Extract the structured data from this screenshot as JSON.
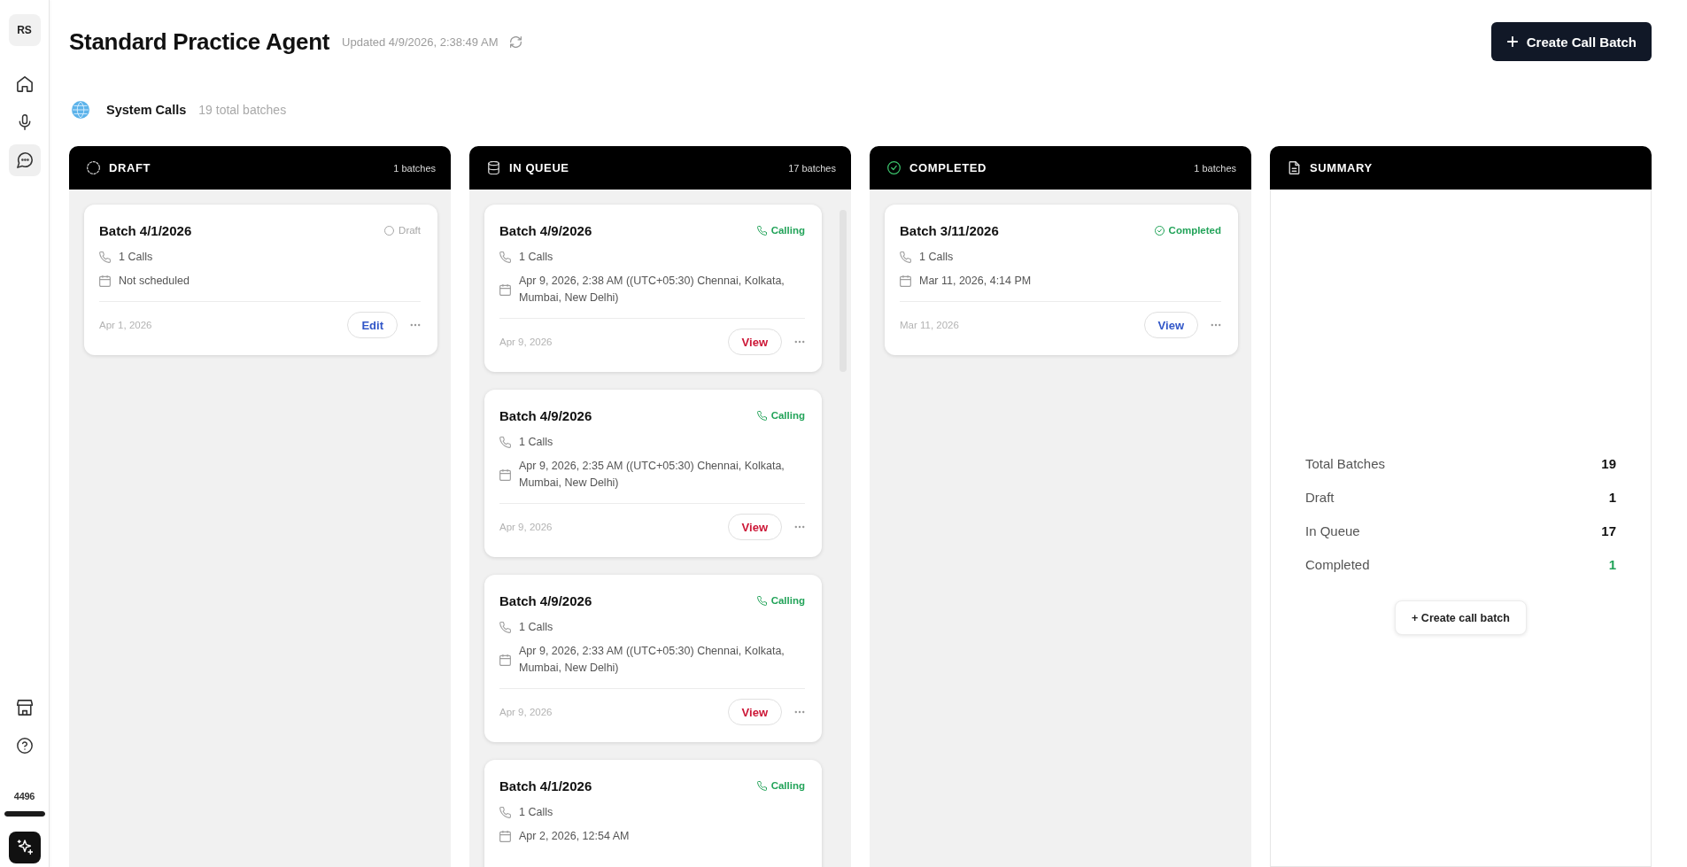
{
  "sidebar": {
    "avatar": "RS",
    "nav_items": [
      {
        "kind": "home",
        "selected": false
      },
      {
        "kind": "mic",
        "selected": false
      },
      {
        "kind": "chat",
        "selected": true
      }
    ],
    "footer_items": [
      {
        "kind": "store"
      },
      {
        "kind": "help"
      }
    ],
    "credits": {
      "value": "4496",
      "level": 1
    }
  },
  "header": {
    "title": "Standard Practice Agent",
    "updated": "Updated 4/9/2026, 2:38:49 AM",
    "create_button": "Create Call Batch"
  },
  "source": {
    "name": "System Calls",
    "count": "19 total batches"
  },
  "columns": [
    {
      "kind": "draft",
      "title": "DRAFT",
      "count": "1 batches",
      "scrollable": false,
      "cards": [
        {
          "title": "Batch 4/1/2026",
          "status": {
            "kind": "draft",
            "label": "Draft"
          },
          "calls": "1 Calls",
          "schedule": "Not scheduled",
          "date": "Apr 1, 2026",
          "action": {
            "kind": "primary",
            "label": "Edit"
          }
        }
      ]
    },
    {
      "kind": "queue",
      "title": "IN QUEUE",
      "count": "17 batches",
      "scrollable": true,
      "cards": [
        {
          "title": "Batch 4/9/2026",
          "status": {
            "kind": "calling",
            "label": "Calling"
          },
          "calls": "1 Calls",
          "schedule": "Apr 9, 2026, 2:38 AM ((UTC+05:30) Chennai, Kolkata, Mumbai, New Delhi)",
          "date": "Apr 9, 2026",
          "action": {
            "kind": "danger",
            "label": "View"
          }
        },
        {
          "title": "Batch 4/9/2026",
          "status": {
            "kind": "calling",
            "label": "Calling"
          },
          "calls": "1 Calls",
          "schedule": "Apr 9, 2026, 2:35 AM ((UTC+05:30) Chennai, Kolkata, Mumbai, New Delhi)",
          "date": "Apr 9, 2026",
          "action": {
            "kind": "danger",
            "label": "View"
          }
        },
        {
          "title": "Batch 4/9/2026",
          "status": {
            "kind": "calling",
            "label": "Calling"
          },
          "calls": "1 Calls",
          "schedule": "Apr 9, 2026, 2:33 AM ((UTC+05:30) Chennai, Kolkata, Mumbai, New Delhi)",
          "date": "Apr 9, 2026",
          "action": {
            "kind": "danger",
            "label": "View"
          }
        },
        {
          "title": "Batch 4/1/2026",
          "status": {
            "kind": "calling",
            "label": "Calling"
          },
          "calls": "1 Calls",
          "schedule": "Apr 2, 2026, 12:54 AM"
        }
      ]
    },
    {
      "kind": "completed",
      "title": "COMPLETED",
      "count": "1 batches",
      "scrollable": false,
      "cards": [
        {
          "title": "Batch 3/11/2026",
          "status": {
            "kind": "completed",
            "label": "Completed"
          },
          "calls": "1 Calls",
          "schedule": "Mar 11, 2026, 4:14 PM",
          "date": "Mar 11, 2026",
          "action": {
            "kind": "primary",
            "label": "View"
          }
        }
      ]
    }
  ],
  "summary": {
    "title": "SUMMARY",
    "stats": [
      {
        "kind": "plain",
        "label": "Total Batches",
        "value": "19"
      },
      {
        "kind": "plain",
        "label": "Draft",
        "value": "1"
      },
      {
        "kind": "plain",
        "label": "In Queue",
        "value": "17"
      },
      {
        "kind": "success",
        "label": "Completed",
        "value": "1"
      }
    ],
    "button": "+ Create call batch"
  }
}
